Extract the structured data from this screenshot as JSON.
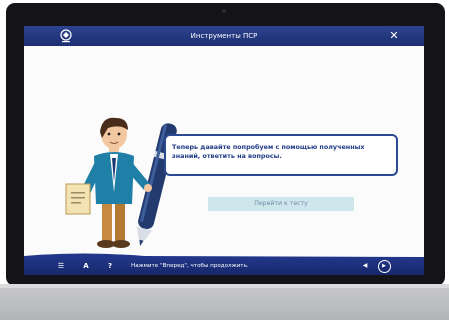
{
  "window": {
    "title": "Инструменты ПСР"
  },
  "icons": {
    "logo": "company-logo-icon",
    "close": "close-icon",
    "menu": "list-icon",
    "font": "font-size-icon",
    "help": "help-icon",
    "back": "back-arrow-icon",
    "forward": "forward-arrow-icon"
  },
  "content": {
    "message_line1": "Теперь давайте попробуем с помощью полученных",
    "message_line2": "знаний, ответить на вопросы.",
    "test_button": "Перейти к тесту"
  },
  "footer": {
    "menu_symbol": "☰",
    "font_symbol": "A",
    "help_symbol": "?",
    "hint": "Нажмите \"Вперед\", чтобы продолжить.",
    "back_symbol": "◀",
    "forward_symbol": "▶"
  },
  "colors": {
    "bar": "#1c2f72",
    "accent": "#2b4a91",
    "button_bg": "#cfe6ed"
  }
}
